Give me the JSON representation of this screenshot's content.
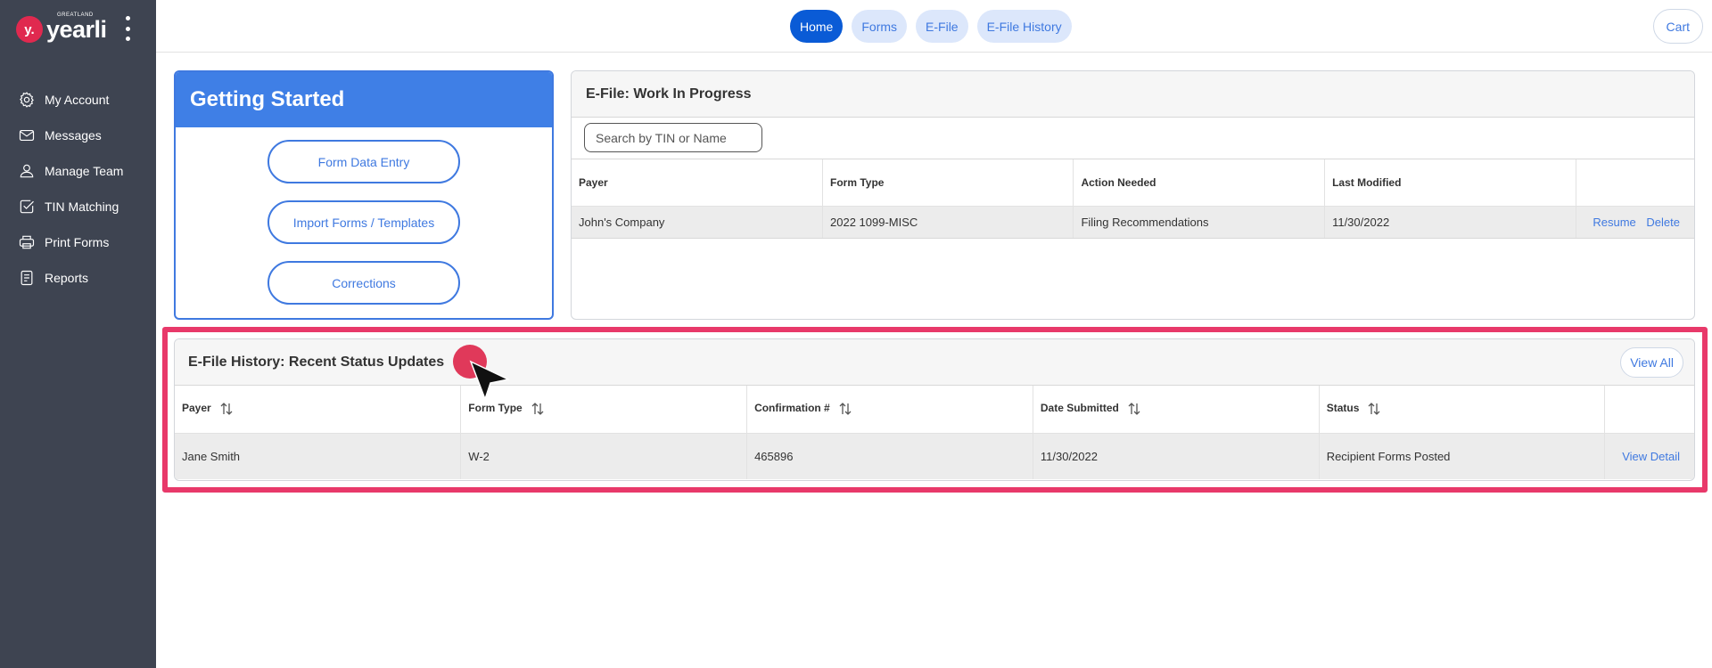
{
  "brand": {
    "badge": "y.",
    "name": "yearli",
    "small_text": "GREATLAND"
  },
  "sidebar": {
    "items": [
      {
        "label": "My Account",
        "icon": "gear-icon"
      },
      {
        "label": "Messages",
        "icon": "mail-icon"
      },
      {
        "label": "Manage Team",
        "icon": "user-icon"
      },
      {
        "label": "TIN Matching",
        "icon": "check-doc-icon"
      },
      {
        "label": "Print Forms",
        "icon": "printer-icon"
      },
      {
        "label": "Reports",
        "icon": "report-icon"
      }
    ]
  },
  "topnav": {
    "tabs": [
      {
        "label": "Home",
        "active": true
      },
      {
        "label": "Forms",
        "active": false
      },
      {
        "label": "E-File",
        "active": false
      },
      {
        "label": "E-File History",
        "active": false
      }
    ],
    "cart_label": "Cart"
  },
  "getting_started": {
    "title": "Getting Started",
    "buttons": [
      "Form Data Entry",
      "Import Forms / Templates",
      "Corrections"
    ]
  },
  "work_in_progress": {
    "title": "E-File: Work In Progress",
    "search_placeholder": "Search by TIN or Name",
    "columns": [
      "Payer",
      "Form Type",
      "Action Needed",
      "Last Modified"
    ],
    "rows": [
      {
        "payer": "John's Company",
        "form_type": "2022 1099-MISC",
        "action_needed": "Filing Recommendations",
        "last_modified": "11/30/2022",
        "resume_label": "Resume",
        "delete_label": "Delete"
      }
    ]
  },
  "history": {
    "title": "E-File History: Recent Status Updates",
    "view_all_label": "View All",
    "columns": [
      "Payer",
      "Form Type",
      "Confirmation #",
      "Date Submitted",
      "Status"
    ],
    "rows": [
      {
        "payer": "Jane Smith",
        "form_type": "W-2",
        "confirmation": "465896",
        "date_submitted": "11/30/2022",
        "status": "Recipient Forms Posted",
        "detail_label": "View Detail"
      }
    ]
  },
  "colors": {
    "sidebar_bg": "#3e4451",
    "primary": "#3f79e0",
    "active_tab": "#0a5bd6",
    "highlight": "#e8396a",
    "brand_red": "#e0294f"
  }
}
